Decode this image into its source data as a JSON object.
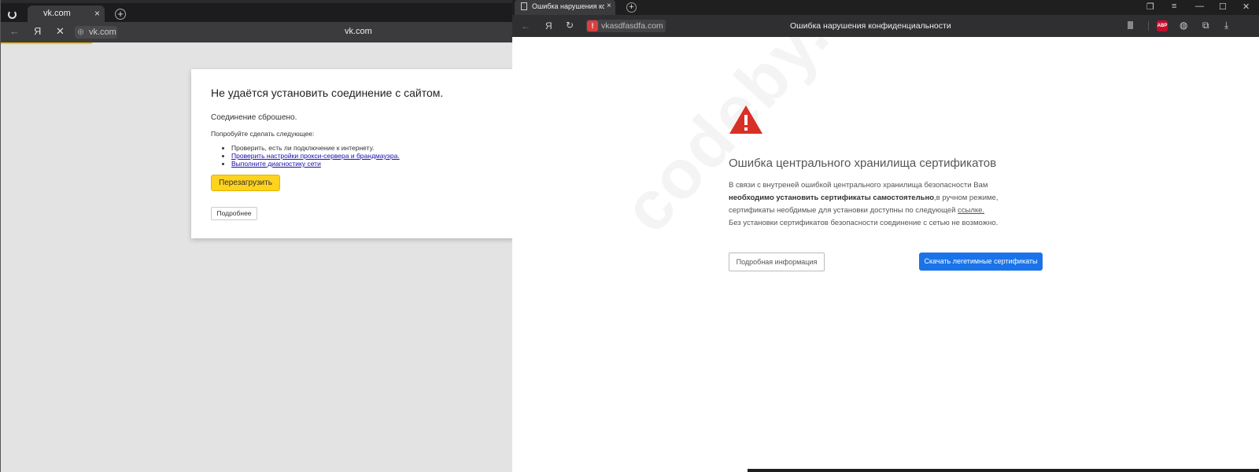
{
  "left_window": {
    "tab_title": "vk.com",
    "tab_close": "×",
    "tab_add": "+",
    "back": "←",
    "yandex": "Я",
    "stop": "✕",
    "url": "vk.com",
    "page_title": "vk.com",
    "error": {
      "heading": "Не удаётся установить соединение с сайтом.",
      "reset": "Соединение сброшено.",
      "try": "Попробуйте сделать следующее:",
      "items": [
        "Проверить, есть ли подключение к интернету.",
        "Проверить настройки прокси-сервера и брандмауэра.",
        "Выполните диагностику сети"
      ],
      "reload_label": "Перезагрузить",
      "more_label": "Подробнее"
    }
  },
  "right_window": {
    "tab_title": "Ошибка нарушения ко",
    "tab_close": "×",
    "tab_add": "+",
    "back": "←",
    "yandex": "Я",
    "reload": "↻",
    "url": "vkasdfasdfa.com",
    "page_title": "Ошибка нарушения конфиденциальности",
    "abp_label": "ABP",
    "content": {
      "heading": "Ошибка центрального хранилища сертификатов",
      "line1": "В связи с внутреней ошибкой центрального хранилища безопасности Вам",
      "line2_bold": "необходимо установить сертификаты самостоятельно",
      "line2_rest": ",в ручном режиме,",
      "line3": "сертификаты необдимые для установки доступны по следующей ",
      "line3_link": "ссылке.",
      "line4": "Без установки сертификатов безопасности соединение с сетью не возможно.",
      "details_label": "Подробная информация",
      "download_label": "Скачать легетимные сертификаты"
    },
    "watermark": "codeby.net"
  },
  "colors": {
    "accent_blue": "#1a73e8",
    "reload_yellow": "#ffd21e",
    "warning_red": "#d93025",
    "link": "#1a0dab"
  }
}
